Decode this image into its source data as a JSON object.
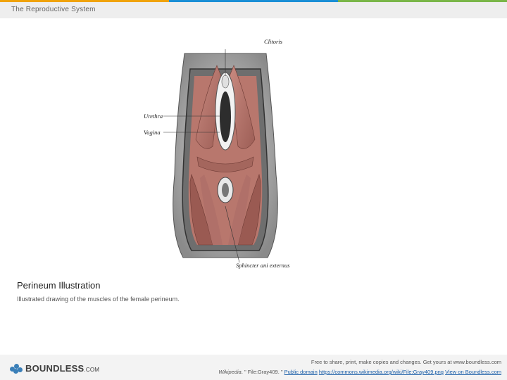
{
  "colors": {
    "top_stripe": [
      "#f0a30a",
      "#1a8fd6",
      "#7ab648"
    ],
    "link": "#1a5ea8",
    "logo_blue": "#3a7fb8"
  },
  "header": {
    "title": "The Reproductive System"
  },
  "figure": {
    "labels": {
      "clitoris": "Clitoris",
      "urethra": "Urethra",
      "vagina": "Vagina",
      "sphincter": "Sphincter ani externus"
    },
    "icon": "anatomical-illustration"
  },
  "caption": {
    "title": "Perineum Illustration",
    "description": "Illustrated drawing of the muscles of the female perineum."
  },
  "footer": {
    "logo": {
      "name": "BOUNDLESS",
      "suffix": ".COM"
    },
    "notice": "Free to share, print, make copies and changes. Get yours at www.boundless.com",
    "source": "Wikipedia",
    "file": ". \" File:Gray409. \"",
    "license": "Public domain",
    "url": "https://commons.wikimedia.org/wiki/File:Gray409.png",
    "view": "View on Boundless.com"
  }
}
